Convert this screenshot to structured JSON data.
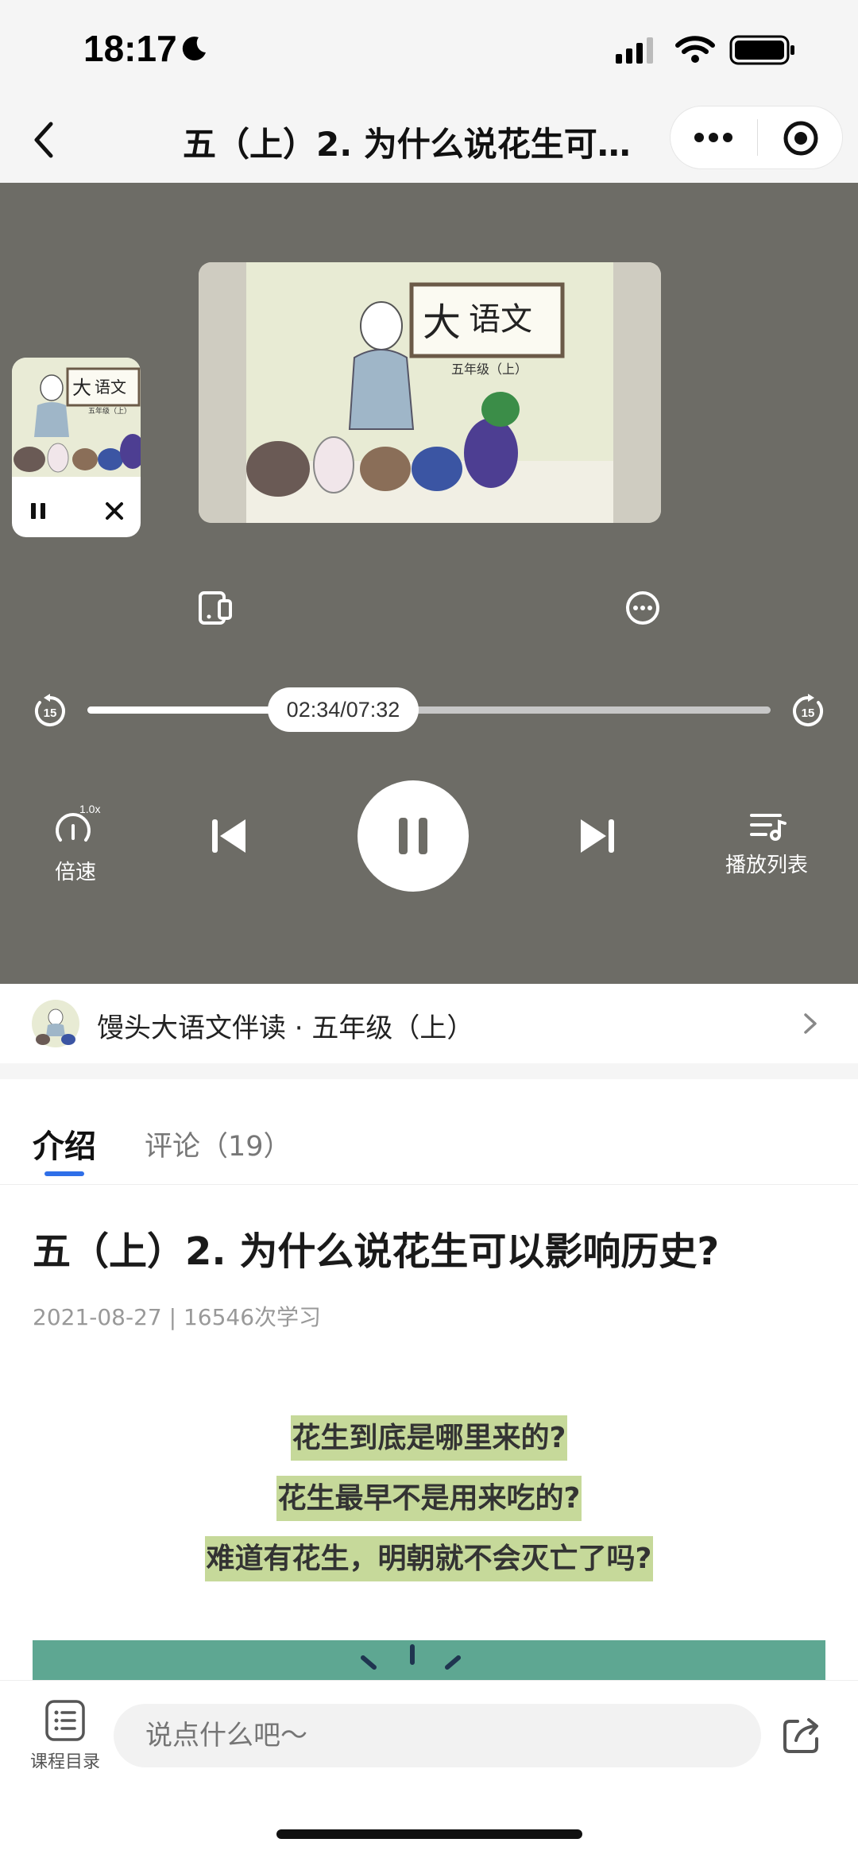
{
  "status_bar": {
    "time": "18:17"
  },
  "nav": {
    "title": "五（上）2. 为什么说花生可…"
  },
  "player": {
    "progress_time": "02:34/07:32",
    "progress_fraction": 0.34,
    "speed_badge": "1.0x",
    "speed_label": "倍速",
    "playlist_label": "播放列表",
    "skip_back_seconds": "15",
    "skip_forward_seconds": "15",
    "main_thumb_text": {
      "big": "大",
      "rest": "语文",
      "sub": "五年级（上）"
    },
    "mini_thumb_text": {
      "big": "大",
      "rest": "语文",
      "sub": "五年级（上）"
    }
  },
  "album": {
    "title": "馒头大语文伴读 · 五年级（上）"
  },
  "tabs": [
    {
      "label": "介绍",
      "active": true
    },
    {
      "label": "评论（19）",
      "active": false
    }
  ],
  "article": {
    "title": "五（上）2. 为什么说花生可以影响历史?",
    "meta": "2021-08-27 | 16546次学习",
    "highlights": [
      "花生到底是哪里来的?",
      "花生最早不是用来吃的?",
      "难道有花生，明朝就不会灭亡了吗?"
    ]
  },
  "bottom": {
    "catalog_label": "课程目录",
    "comment_placeholder": "说点什么吧～"
  },
  "colors": {
    "player_bg": "#6d6c66",
    "accent": "#2f6fe8",
    "highlight": "#c6d99a",
    "green_block": "#5ea792"
  }
}
